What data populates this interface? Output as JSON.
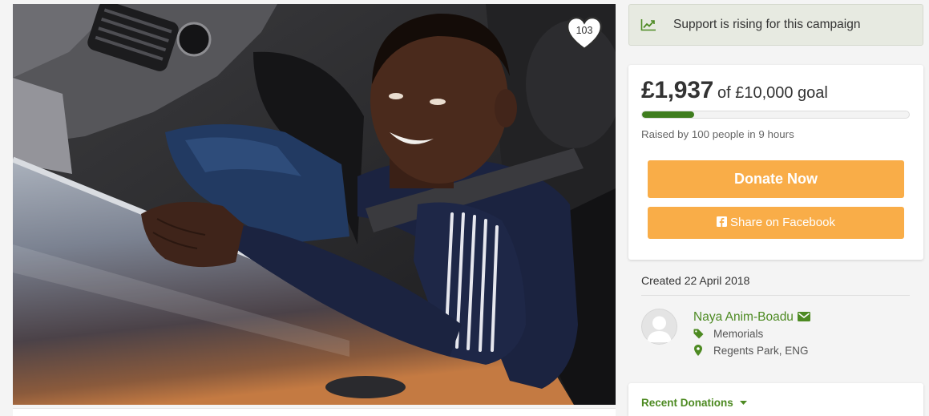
{
  "photo": {
    "heart_icon": "heart-icon",
    "heart_count": "103"
  },
  "banner": {
    "icon": "trending-up-icon",
    "text": "Support is rising for this campaign"
  },
  "progress": {
    "raised": "£1,937",
    "goal": "of £10,000 goal",
    "fill_fraction": 0.1937,
    "summary": "Raised by 100 people in 9 hours"
  },
  "actions": {
    "donate_label": "Donate Now",
    "share_icon": "facebook-icon",
    "share_label": "Share on Facebook"
  },
  "details": {
    "created": "Created 22 April 2018"
  },
  "organizer": {
    "avatar_icon": "user-avatar-icon",
    "name": "Naya Anim-Boadu",
    "contact_icon": "envelope-icon",
    "category_icon": "tag-icon",
    "category": "Memorials",
    "location_icon": "map-marker-icon",
    "location": "Regents Park, ENG"
  },
  "recent_donations": {
    "label": "Recent Donations",
    "icon": "caret-down-icon"
  },
  "colors": {
    "page_bg": "#f4f4f4",
    "accent_green": "#4d8a22",
    "progress_green": "#3f7d1e",
    "button_orange": "#f9ad48",
    "banner_bg": "#e7eae1"
  }
}
